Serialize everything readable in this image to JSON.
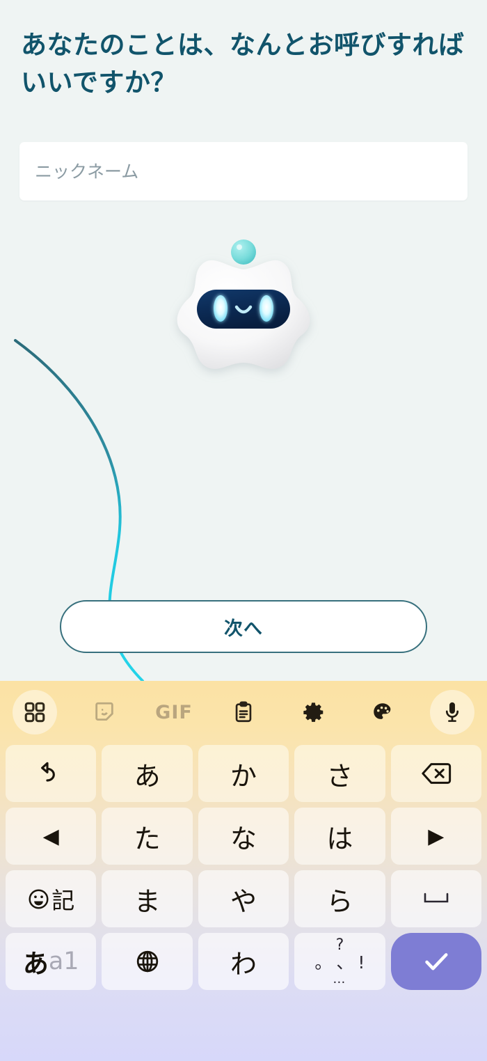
{
  "screen": {
    "background_color": "#eff4f3",
    "title": "あなたのことは、なんとお呼びすればいいですか？",
    "title_color": "#11546b"
  },
  "form": {
    "nickname_placeholder": "ニックネーム",
    "nickname_value": "",
    "field_background": "#ffffff"
  },
  "mascot": {
    "name": "robot-mascot",
    "body_color": "#f4f4f5",
    "visor_color": "#0d2d5c",
    "eye_color": "#b7f2ff",
    "antenna_color": "#6fd8d8"
  },
  "decoration": {
    "line_color_top": "#2b6b7a",
    "line_color_bottom": "#24d3e8"
  },
  "next_button": {
    "label": "次へ",
    "border_color": "#37707d",
    "text_color": "#11546b",
    "background": "#ffffff"
  },
  "keyboard": {
    "gradient_top": "#fbe2a4",
    "gradient_bottom": "#d7d8fa",
    "toolbar": [
      {
        "icon": "grid-icon",
        "label": "",
        "highlight": true,
        "muted": false
      },
      {
        "icon": "sticker-icon",
        "label": "",
        "highlight": false,
        "muted": true
      },
      {
        "icon": "gif-icon",
        "label": "GIF",
        "highlight": false,
        "muted": true
      },
      {
        "icon": "clipboard-icon",
        "label": "",
        "highlight": false,
        "muted": false
      },
      {
        "icon": "gear-icon",
        "label": "",
        "highlight": false,
        "muted": false
      },
      {
        "icon": "palette-icon",
        "label": "",
        "highlight": false,
        "muted": false
      },
      {
        "icon": "microphone-icon",
        "label": "",
        "highlight": true,
        "muted": false
      }
    ],
    "rows": [
      [
        {
          "name": "key-undo",
          "label": "",
          "icon": "undo-icon"
        },
        {
          "name": "key-a",
          "label": "あ",
          "icon": ""
        },
        {
          "name": "key-ka",
          "label": "か",
          "icon": ""
        },
        {
          "name": "key-sa",
          "label": "さ",
          "icon": ""
        },
        {
          "name": "key-backspace",
          "label": "",
          "icon": "backspace-icon"
        }
      ],
      [
        {
          "name": "key-cursor-left",
          "label": "◀",
          "icon": ""
        },
        {
          "name": "key-ta",
          "label": "た",
          "icon": ""
        },
        {
          "name": "key-na",
          "label": "な",
          "icon": ""
        },
        {
          "name": "key-ha",
          "label": "は",
          "icon": ""
        },
        {
          "name": "key-cursor-right",
          "label": "▶",
          "icon": ""
        }
      ],
      [
        {
          "name": "key-emoji-symbol",
          "label": "記",
          "icon": "smiley-icon"
        },
        {
          "name": "key-ma",
          "label": "ま",
          "icon": ""
        },
        {
          "name": "key-ya",
          "label": "や",
          "icon": ""
        },
        {
          "name": "key-ra",
          "label": "ら",
          "icon": ""
        },
        {
          "name": "key-space",
          "label": "␣",
          "icon": ""
        }
      ],
      [
        {
          "name": "key-input-mode",
          "label_ja": "あ",
          "label_en": "a1"
        },
        {
          "name": "key-language",
          "label": "",
          "icon": "globe-icon"
        },
        {
          "name": "key-wa",
          "label": "わ",
          "icon": ""
        },
        {
          "name": "key-punctuation",
          "q": "?",
          "maru": "。",
          "ten": "、",
          "bang": "!",
          "dots": "…"
        },
        {
          "name": "key-enter",
          "label": "",
          "icon": "check-icon",
          "color": "#7e7dd4"
        }
      ]
    ]
  }
}
